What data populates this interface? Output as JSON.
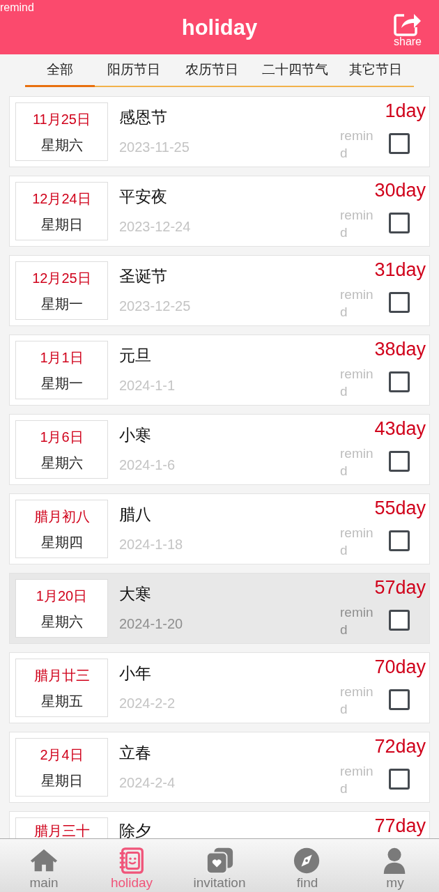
{
  "header": {
    "corner_label": "remind",
    "title": "holiday",
    "share_label": "share"
  },
  "tabs": [
    {
      "label": "全部",
      "selected": true
    },
    {
      "label": "阳历节日",
      "selected": false
    },
    {
      "label": "农历节日",
      "selected": false
    },
    {
      "label": "二十四节气",
      "selected": false
    },
    {
      "label": "其它节日",
      "selected": false
    }
  ],
  "holidays": [
    {
      "date_label": "11月25日",
      "weekday": "星期六",
      "name": "感恩节",
      "date": "2023-11-25",
      "days": "1day",
      "remind_label": "remind",
      "checked": false,
      "selected": false
    },
    {
      "date_label": "12月24日",
      "weekday": "星期日",
      "name": "平安夜",
      "date": "2023-12-24",
      "days": "30day",
      "remind_label": "remind",
      "checked": false,
      "selected": false
    },
    {
      "date_label": "12月25日",
      "weekday": "星期一",
      "name": "圣诞节",
      "date": "2023-12-25",
      "days": "31day",
      "remind_label": "remind",
      "checked": false,
      "selected": false
    },
    {
      "date_label": "1月1日",
      "weekday": "星期一",
      "name": "元旦",
      "date": "2024-1-1",
      "days": "38day",
      "remind_label": "remind",
      "checked": false,
      "selected": false
    },
    {
      "date_label": "1月6日",
      "weekday": "星期六",
      "name": "小寒",
      "date": "2024-1-6",
      "days": "43day",
      "remind_label": "remind",
      "checked": false,
      "selected": false
    },
    {
      "date_label": "腊月初八",
      "weekday": "星期四",
      "name": "腊八",
      "date": "2024-1-18",
      "days": "55day",
      "remind_label": "remind",
      "checked": false,
      "selected": false
    },
    {
      "date_label": "1月20日",
      "weekday": "星期六",
      "name": "大寒",
      "date": "2024-1-20",
      "days": "57day",
      "remind_label": "remind",
      "checked": false,
      "selected": true
    },
    {
      "date_label": "腊月廿三",
      "weekday": "星期五",
      "name": "小年",
      "date": "2024-2-2",
      "days": "70day",
      "remind_label": "remind",
      "checked": false,
      "selected": false
    },
    {
      "date_label": "2月4日",
      "weekday": "星期日",
      "name": "立春",
      "date": "2024-2-4",
      "days": "72day",
      "remind_label": "remind",
      "checked": false,
      "selected": false
    },
    {
      "date_label": "腊月三十",
      "name": "除夕",
      "days": "77day",
      "selected": false
    }
  ],
  "bottom_nav": [
    {
      "label": "main",
      "selected": false
    },
    {
      "label": "holiday",
      "selected": true
    },
    {
      "label": "invitation",
      "selected": false
    },
    {
      "label": "find",
      "selected": false
    },
    {
      "label": "my",
      "selected": false
    }
  ]
}
